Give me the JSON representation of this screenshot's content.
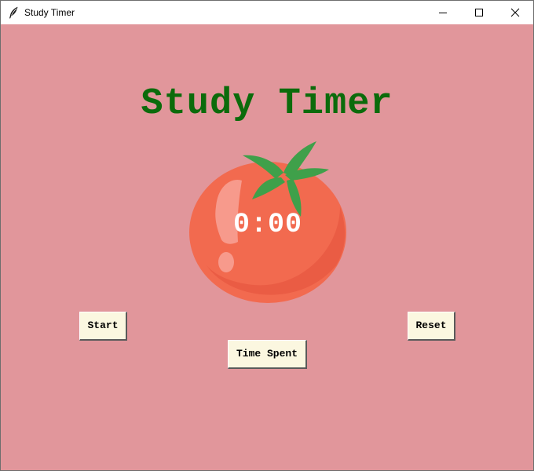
{
  "window": {
    "title": "Study Timer",
    "icon": "feather-icon",
    "controls": {
      "minimize": "minimize-icon",
      "maximize": "maximize-icon",
      "close": "close-icon"
    }
  },
  "app": {
    "heading": "Study Timer",
    "timer": "0:00",
    "image": "tomato-icon",
    "buttons": {
      "start": "Start",
      "reset": "Reset",
      "time_spent": "Time Spent"
    }
  },
  "colors": {
    "background": "#e1969b",
    "heading": "#0b6b0b",
    "button_face": "#fbf7e0",
    "timer_text": "#ffffff",
    "tomato": "#f0664e",
    "leaves": "#3fa04a"
  }
}
